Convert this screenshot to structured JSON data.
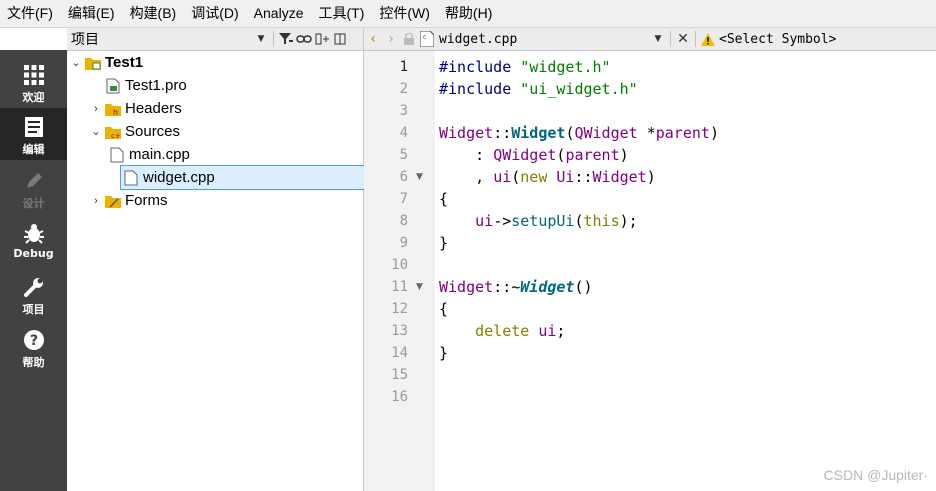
{
  "menu": [
    "文件(F)",
    "编辑(E)",
    "构建(B)",
    "调试(D)",
    "Analyze",
    "工具(T)",
    "控件(W)",
    "帮助(H)"
  ],
  "modes": [
    {
      "label": "欢迎",
      "icon": "grid-icon"
    },
    {
      "label": "编辑",
      "icon": "document-icon"
    },
    {
      "label": "设计",
      "icon": "pencil-icon"
    },
    {
      "label": "Debug",
      "icon": "bug-icon"
    },
    {
      "label": "项目",
      "icon": "wrench-icon"
    },
    {
      "label": "帮助",
      "icon": "help-icon"
    }
  ],
  "project_panel": {
    "title": "项目"
  },
  "tree": [
    {
      "label": "Test1",
      "expanded": true,
      "bold": true
    },
    {
      "label": "Test1.pro"
    },
    {
      "label": "Headers",
      "expanded": false
    },
    {
      "label": "Sources",
      "expanded": true
    },
    {
      "label": "main.cpp"
    },
    {
      "label": "widget.cpp",
      "selected": true
    },
    {
      "label": "Forms",
      "expanded": false
    }
  ],
  "editor": {
    "filename": "widget.cpp",
    "symbol": "<Select Symbol>",
    "current_line": 1,
    "lines": [
      "1",
      "2",
      "3",
      "4",
      "5",
      "6",
      "7",
      "8",
      "9",
      "10",
      "11",
      "12",
      "13",
      "14",
      "15",
      "16"
    ]
  },
  "watermark": "CSDN @Jupiter·"
}
